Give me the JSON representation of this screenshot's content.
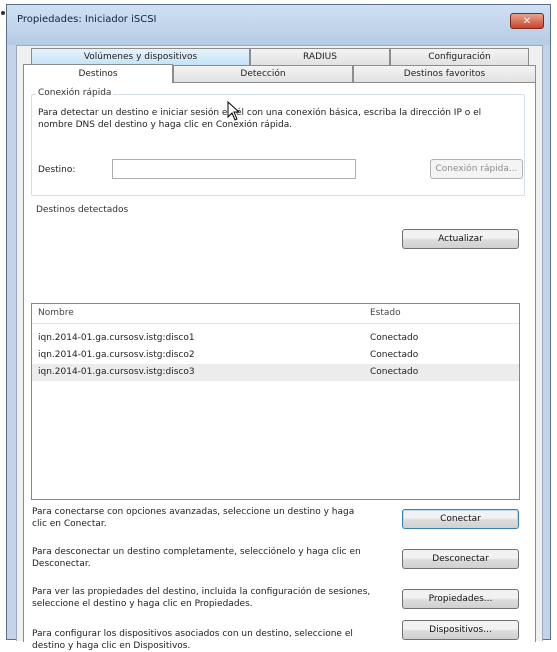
{
  "window": {
    "title": "Propiedades: Iniciador iSCSI",
    "close_glyph": "✕"
  },
  "tabs": {
    "top_row": [
      "Volúmenes y dispositivos",
      "RADIUS",
      "Configuración"
    ],
    "bottom_row": [
      "Destinos",
      "Detección",
      "Destinos favoritos"
    ],
    "active": "Destinos"
  },
  "quick_connect": {
    "legend": "Conexión rápida",
    "description": "Para detectar un destino e iniciar sesión en él con una conexión básica, escriba la dirección IP o el nombre DNS del destino y haga clic en Conexión rápida.",
    "target_label": "Destino:",
    "target_value": "",
    "button": "Conexión rápida..."
  },
  "discovered": {
    "legend": "Destinos detectados",
    "refresh_button": "Actualizar",
    "columns": [
      "Nombre",
      "Estado"
    ],
    "rows": [
      {
        "name": "iqn.2014-01.ga.cursosv.istg:disco1",
        "status": "Conectado"
      },
      {
        "name": "iqn.2014-01.ga.cursosv.istg:disco2",
        "status": "Conectado"
      },
      {
        "name": "iqn.2014-01.ga.cursosv.istg:disco3",
        "status": "Conectado"
      }
    ]
  },
  "actions": [
    {
      "text": "Para conectarse con opciones avanzadas, seleccione un destino y haga clic en Conectar.",
      "button": "Conectar"
    },
    {
      "text": "Para desconectar un destino completamente, selecciónelo y haga clic en Desconectar.",
      "button": "Desconectar"
    },
    {
      "text": "Para ver las propiedades del destino, incluida la configuración de sesiones, seleccione el destino y haga clic en Propiedades.",
      "button": "Propiedades..."
    },
    {
      "text": "Para configurar los dispositivos asociados con un destino, seleccione el destino y haga clic en Dispositivos.",
      "button": "Dispositivos..."
    }
  ],
  "colors": {
    "title_bar": "#c3d4e8",
    "close_button": "#c8452a",
    "selection": "#ececec"
  }
}
